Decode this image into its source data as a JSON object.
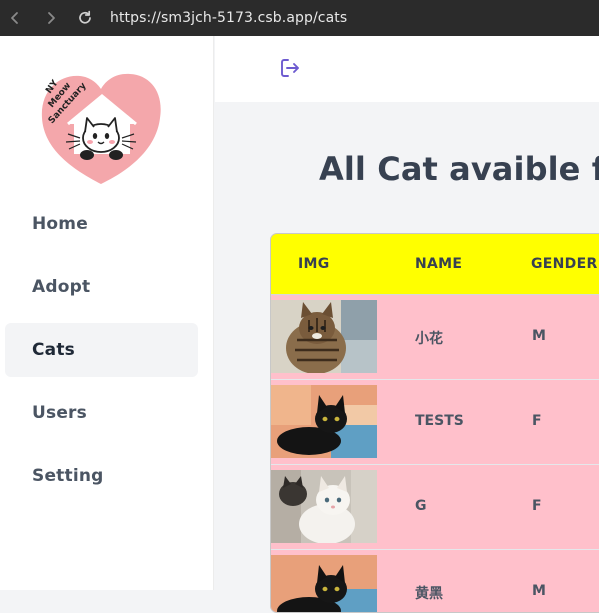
{
  "browser": {
    "url": "https://sm3jch-5173.csb.app/cats"
  },
  "logo": {
    "text_line1": "NY",
    "text_line2": "Meow",
    "text_line3": "Sanctuary"
  },
  "sidebar": {
    "items": [
      {
        "label": "Home",
        "active": false
      },
      {
        "label": "Adopt",
        "active": false
      },
      {
        "label": "Cats",
        "active": true
      },
      {
        "label": "Users",
        "active": false
      },
      {
        "label": "Setting",
        "active": false
      }
    ]
  },
  "header": {
    "logout_icon": "logout-icon"
  },
  "main": {
    "title": "All Cat avaible fo",
    "table": {
      "columns": [
        "IMG",
        "NAME",
        "GENDER"
      ],
      "rows": [
        {
          "name": "小花",
          "gender": "M",
          "photo": "tabby-kitten"
        },
        {
          "name": "TESTS",
          "gender": "F",
          "photo": "black-kitten"
        },
        {
          "name": "G",
          "gender": "F",
          "photo": "white-kitten"
        },
        {
          "name": "黄黑",
          "gender": "M",
          "photo": "black-kitten"
        }
      ]
    }
  },
  "colors": {
    "table_header": "#ffff00",
    "table_row": "#ffc0cb",
    "logo_heart": "#f4a7ab",
    "logout_icon": "#6d5bd0"
  }
}
